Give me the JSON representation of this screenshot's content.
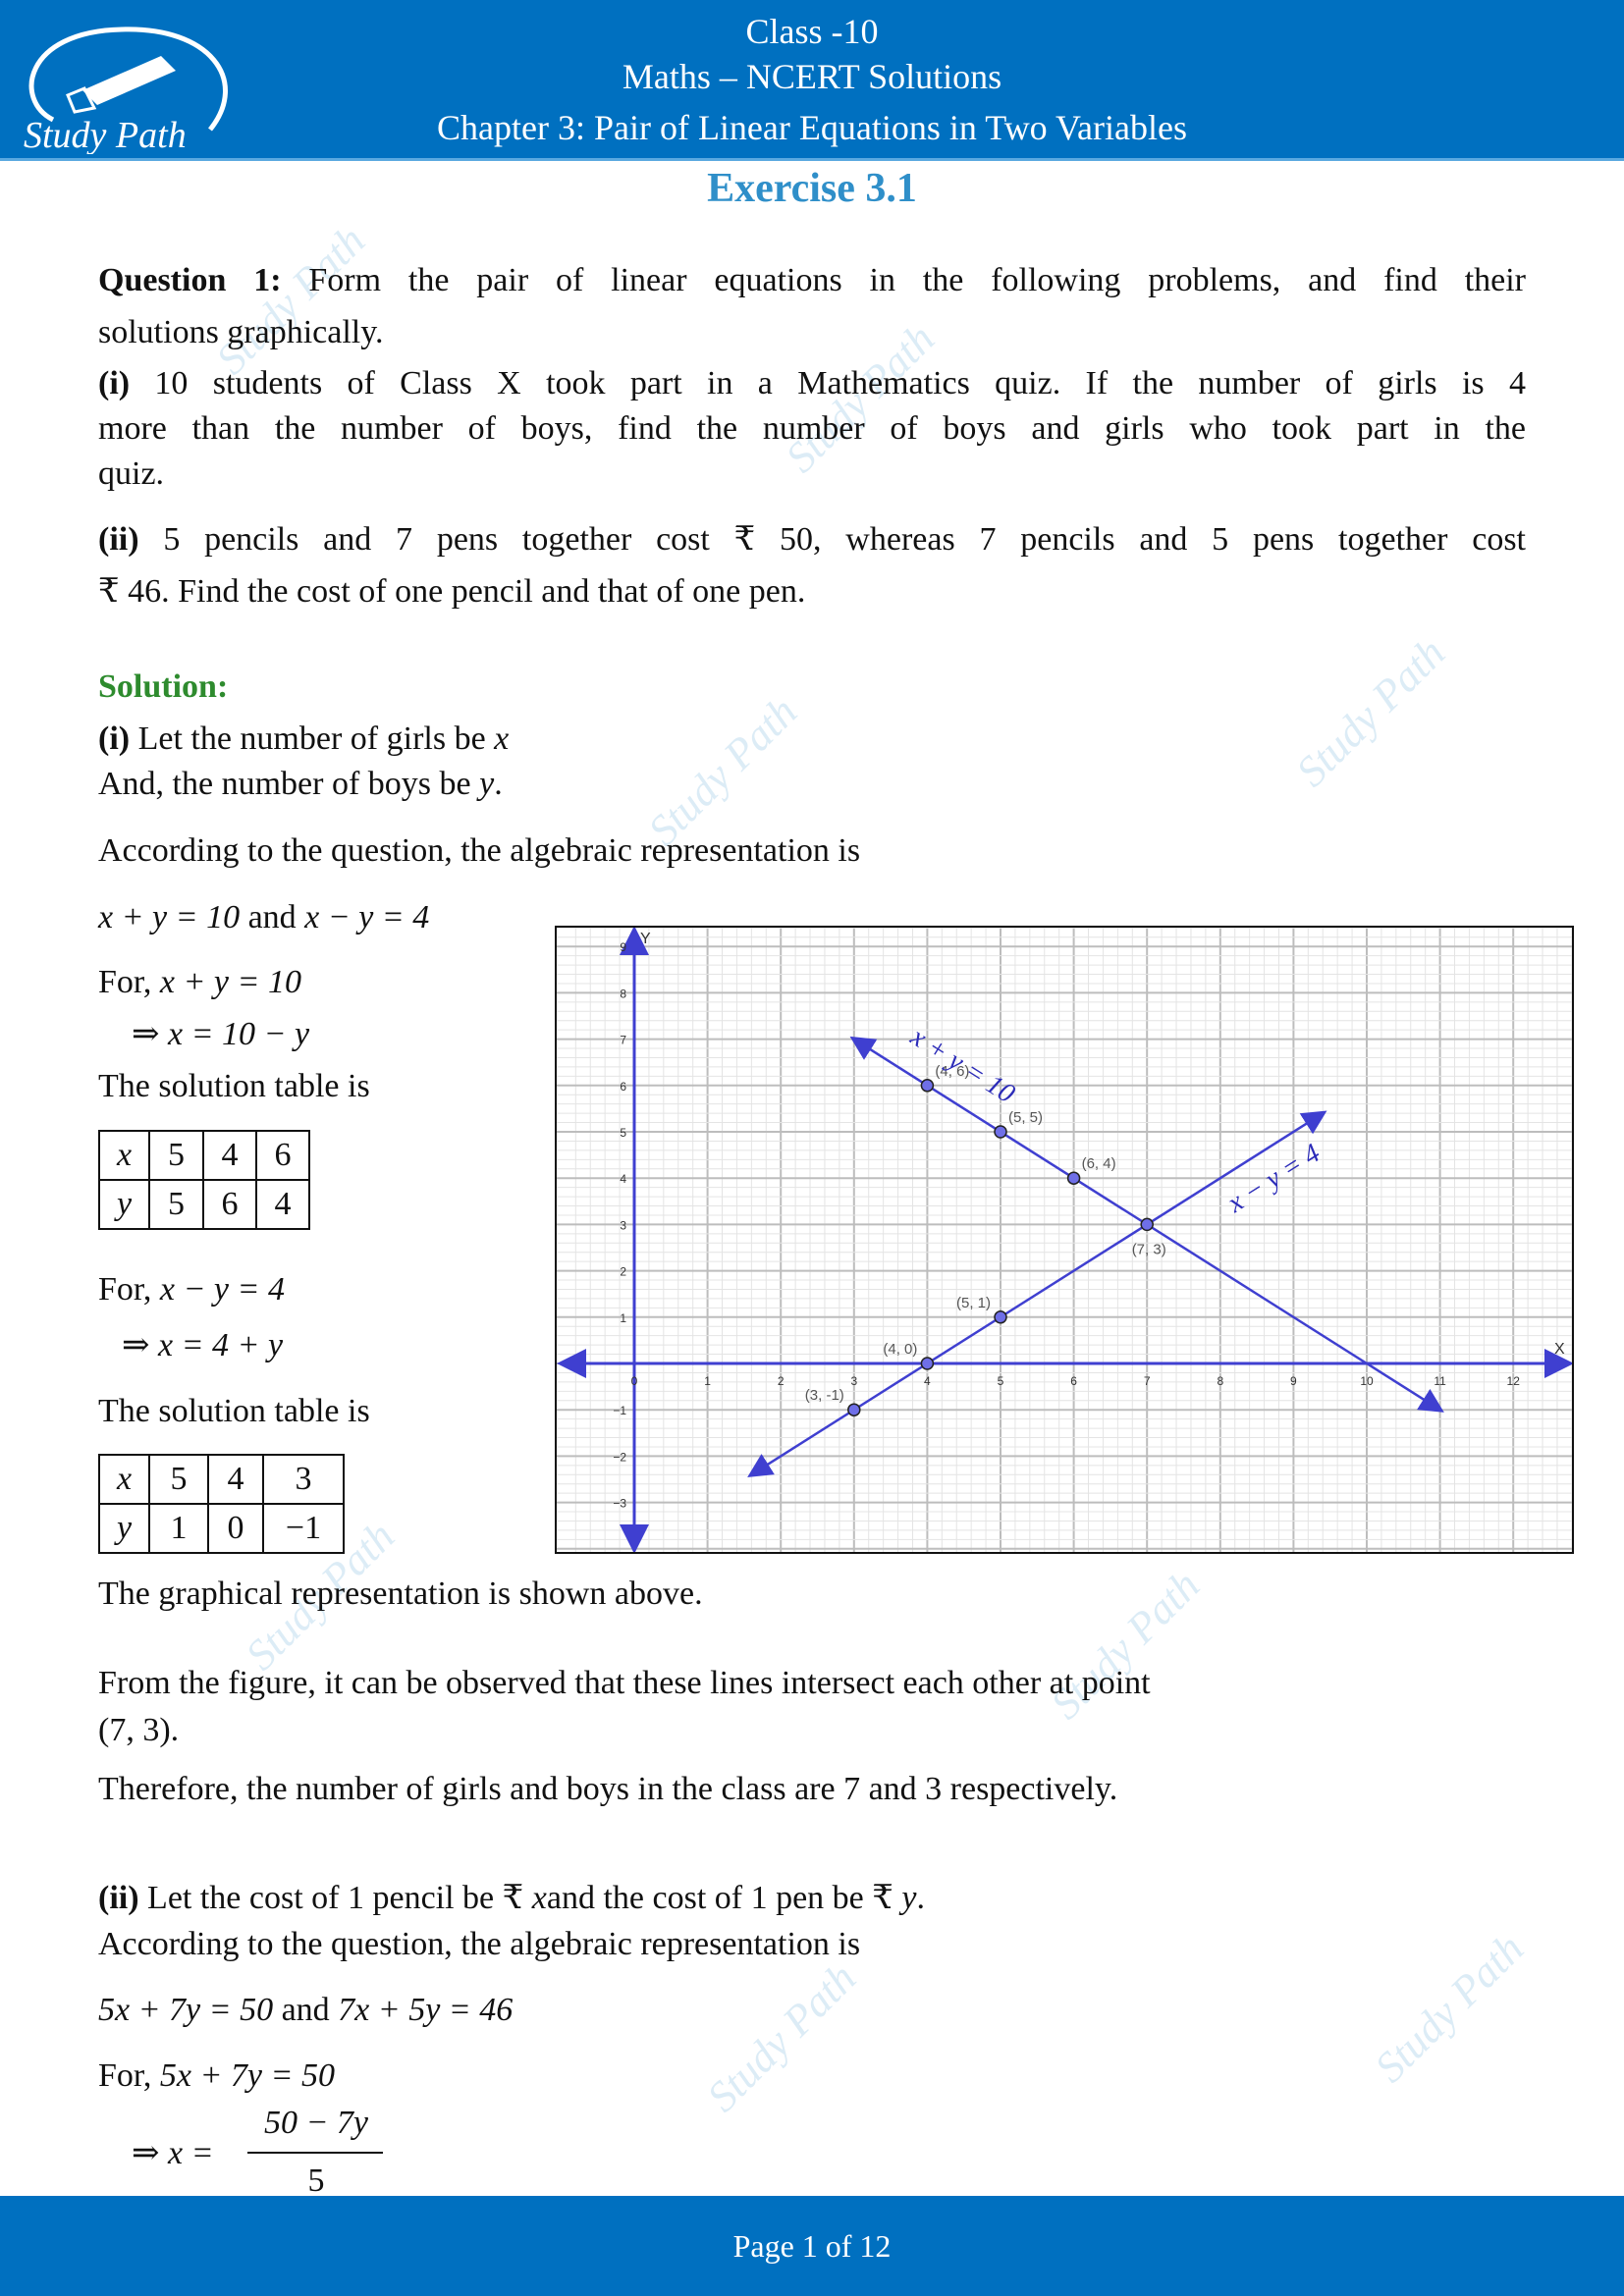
{
  "header": {
    "class": "Class -10",
    "subject": "Maths – NCERT Solutions",
    "chapter": "Chapter 3: Pair of Linear Equations in Two Variables",
    "logo_text": "Study Path"
  },
  "exercise_title": "Exercise 3.1",
  "question": {
    "label": "Question 1:",
    "line1": " Form the pair of linear equations in the following problems, and find their",
    "line2": "solutions graphically.",
    "part_i_label": "(i)",
    "part_i_line1": " 10 students of Class X took part in a Mathematics quiz. If the number of girls is 4",
    "part_i_line2": "more than the number of boys, find the number of boys and girls who took part in the",
    "part_i_line3": "quiz.",
    "part_ii_label": "(ii)",
    "part_ii_line1": " 5 pencils and 7 pens together cost ₹ 50, whereas 7 pencils and 5 pens together cost",
    "part_ii_line2": "₹ 46. Find the cost of one pencil and that of one pen."
  },
  "solution": {
    "label": "Solution:",
    "i_label": "(i)",
    "i_line1": " Let the number of girls be ",
    "var_x": "x",
    "i_line2": "And, the number of boys be ",
    "var_y": "y",
    "period": ".",
    "according": "According to the question, the algebraic representation is",
    "eq1": "x + y = 10",
    "and": " and ",
    "eq2": "x − y = 4",
    "for": "For, ",
    "implies1": "⇒ x = 10 − y",
    "table_intro": "The solution table is",
    "table1": {
      "x_label": "x",
      "y_label": "y",
      "x": [
        "5",
        "4",
        "6"
      ],
      "y": [
        "5",
        "6",
        "4"
      ]
    },
    "implies2": "⇒ x = 4 + y",
    "table2": {
      "x_label": "x",
      "y_label": "y",
      "x": [
        "5",
        "4",
        "3"
      ],
      "y": [
        "1",
        "0",
        "−1"
      ]
    },
    "graph_note": "The graphical representation is shown above.",
    "figure_line1": "From the figure, it can be observed that these lines intersect each other at point",
    "figure_line2": "(7, 3).",
    "conclusion": "Therefore, the number of girls and boys in the class are 7 and 3 respectively.",
    "ii_label": "(ii)",
    "ii_line1a": "  Let the cost of 1 pencil be ₹ ",
    "ii_line1b": "and the cost of 1 pen be ₹ ",
    "according2": "According to the question, the algebraic representation is",
    "eq3": "5x + 7y = 50",
    "eq4": "7x + 5y = 46",
    "implies3_lhs": "⇒ x =",
    "implies3_num": "50 − 7y",
    "implies3_den": "5"
  },
  "chart_data": {
    "type": "line",
    "xlabel": "X",
    "ylabel": "Y",
    "xlim": [
      -0.8,
      12.9
    ],
    "ylim": [
      -4.0,
      9.4
    ],
    "x_ticks": [
      0,
      1,
      2,
      3,
      4,
      5,
      6,
      7,
      8,
      9,
      10,
      11,
      12
    ],
    "y_ticks": [
      -3,
      -2,
      -1,
      1,
      2,
      3,
      4,
      5,
      6,
      7,
      8,
      9
    ],
    "grid": true,
    "line_color": "#3f3fd0",
    "series": [
      {
        "name": "x + y = 10",
        "from": [
          3,
          7
        ],
        "to": [
          11,
          -1
        ],
        "points": [
          {
            "x": 4,
            "y": 6,
            "label": "(4, 6)"
          },
          {
            "x": 5,
            "y": 5,
            "label": "(5, 5)"
          },
          {
            "x": 6,
            "y": 4,
            "label": "(6, 4)"
          }
        ]
      },
      {
        "name": "x − y = 4",
        "from": [
          1.6,
          -2.4
        ],
        "to": [
          9.4,
          5.4
        ],
        "points": [
          {
            "x": 3,
            "y": -1,
            "label": "(3, -1)"
          },
          {
            "x": 4,
            "y": 0,
            "label": "(4, 0)"
          },
          {
            "x": 5,
            "y": 1,
            "label": "(5, 1)"
          },
          {
            "x": 7,
            "y": 3,
            "label": "(7, 3)"
          }
        ]
      }
    ]
  },
  "footer": {
    "page": "Page 1 of 12"
  },
  "watermark": "Study Path"
}
